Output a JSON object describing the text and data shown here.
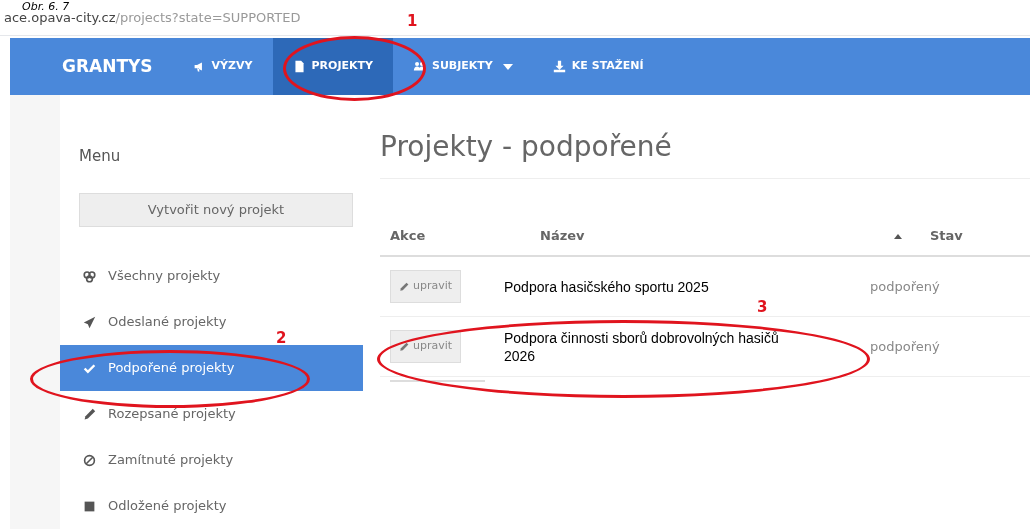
{
  "caption": "Obr. 6. 7",
  "address_bar": {
    "host": "ace.opava-city.cz",
    "path": "/projects?state=SUPPORTED"
  },
  "navbar": {
    "brand": "GRANTYS",
    "items": [
      {
        "label": "VÝZVY",
        "selected": false,
        "dropdown": false
      },
      {
        "label": "PROJEKTY",
        "selected": true,
        "dropdown": false
      },
      {
        "label": "SUBJEKTY",
        "selected": false,
        "dropdown": true
      },
      {
        "label": "KE STAŽENÍ",
        "selected": false,
        "dropdown": false
      }
    ]
  },
  "sidebar": {
    "title": "Menu",
    "button": "Vytvořit nový projekt",
    "items": [
      {
        "label": "Všechny projekty",
        "selected": false
      },
      {
        "label": "Odeslané projekty",
        "selected": false
      },
      {
        "label": "Podpořené projekty",
        "selected": true
      },
      {
        "label": "Rozepsané projekty",
        "selected": false
      },
      {
        "label": "Zamítnuté projekty",
        "selected": false
      },
      {
        "label": "Odložené projekty",
        "selected": false
      }
    ]
  },
  "page_title": "Projekty - podpořené",
  "table": {
    "columns": [
      "Akce",
      "Název",
      "Stav"
    ],
    "rows": [
      {
        "action": "upravit",
        "name": "Podpora hasičského sportu 2025",
        "status": "podpořený"
      },
      {
        "action": "upravit",
        "name": "Podpora činnosti sborů dobrovolných hasičů 2026",
        "status": "podpořený"
      }
    ]
  },
  "annotations": [
    "1",
    "2",
    "3"
  ]
}
